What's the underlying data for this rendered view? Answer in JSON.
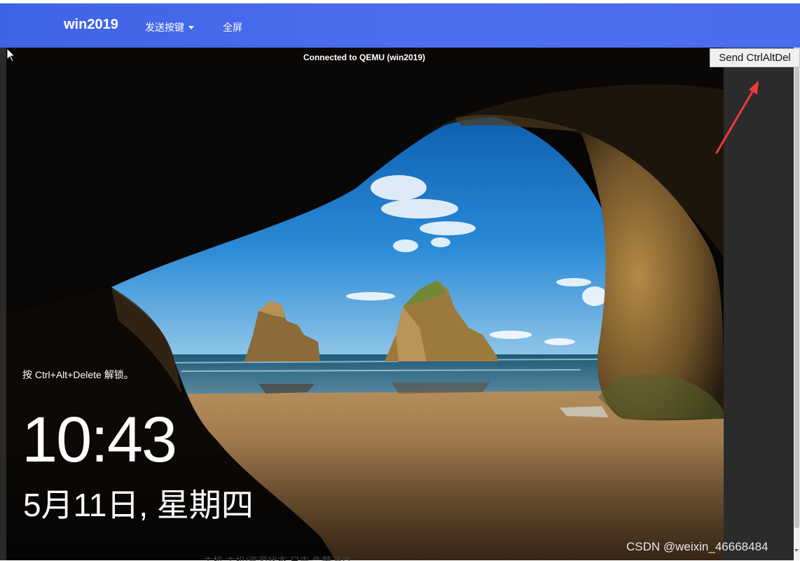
{
  "navbar": {
    "brand": "win2019",
    "send_keys_label": "发送按键",
    "fullscreen_label": "全屏"
  },
  "vnc": {
    "status": "Connected to QEMU (win2019)",
    "send_ctrl_alt_del": "Send CtrlAltDel"
  },
  "lockscreen": {
    "unlock_hint": "按 Ctrl+Alt+Delete 解锁。",
    "time": "10:43",
    "date": "5月11日, 星期四"
  },
  "page": {
    "partial_text": "主机     主机/资源状态     日志     告警消息"
  },
  "watermark": "CSDN @weixin_46668484",
  "colors": {
    "navbar": "#4a6cee",
    "annotation_arrow": "#ef3a3a"
  },
  "icons": {
    "cursor": "mouse-pointer-icon",
    "caret": "caret-down-icon",
    "arrow": "red-annotation-arrow"
  }
}
